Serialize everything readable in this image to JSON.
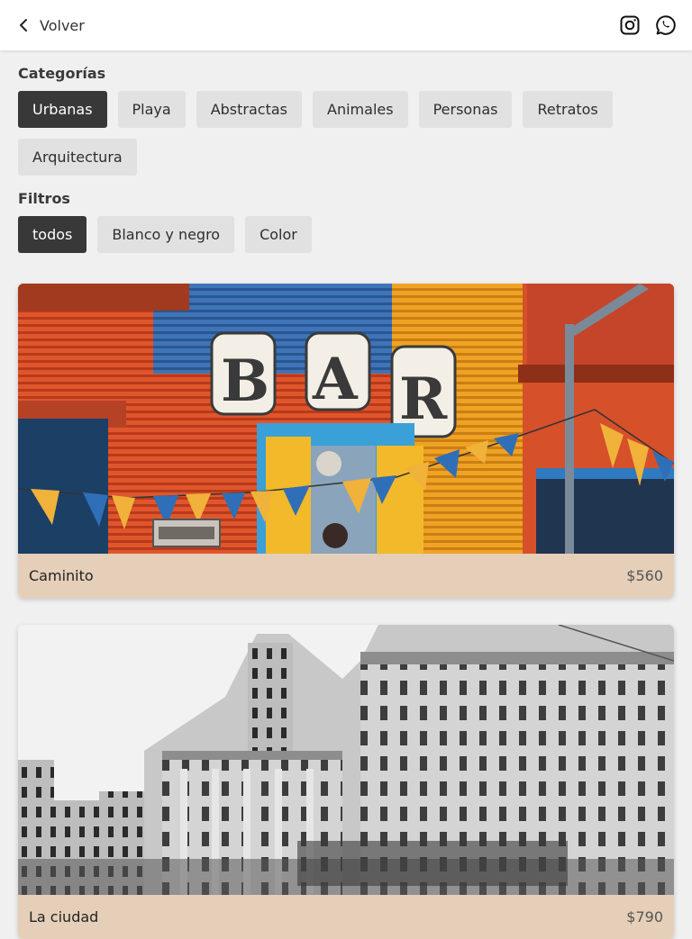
{
  "header": {
    "back_label": "Volver",
    "icons": [
      "chevron-left-icon",
      "instagram-icon",
      "whatsapp-icon"
    ]
  },
  "categories": {
    "title": "Categorías",
    "items": [
      {
        "label": "Urbanas",
        "active": true
      },
      {
        "label": "Playa",
        "active": false
      },
      {
        "label": "Abstractas",
        "active": false
      },
      {
        "label": "Animales",
        "active": false
      },
      {
        "label": "Personas",
        "active": false
      },
      {
        "label": "Retratos",
        "active": false
      },
      {
        "label": "Arquitectura",
        "active": false
      }
    ]
  },
  "filters": {
    "title": "Filtros",
    "items": [
      {
        "label": "todos",
        "active": true
      },
      {
        "label": "Blanco y negro",
        "active": false
      },
      {
        "label": "Color",
        "active": false
      }
    ]
  },
  "photos": [
    {
      "name": "Caminito",
      "price": "$560",
      "style": "color"
    },
    {
      "name": "La ciudad",
      "price": "$790",
      "style": "blanco-y-negro"
    }
  ],
  "colors": {
    "chip_active_bg": "#383838",
    "chip_bg": "#e1e1e1",
    "card_meta_bg": "#e5cfb8",
    "page_bg": "#f0f0f0"
  }
}
